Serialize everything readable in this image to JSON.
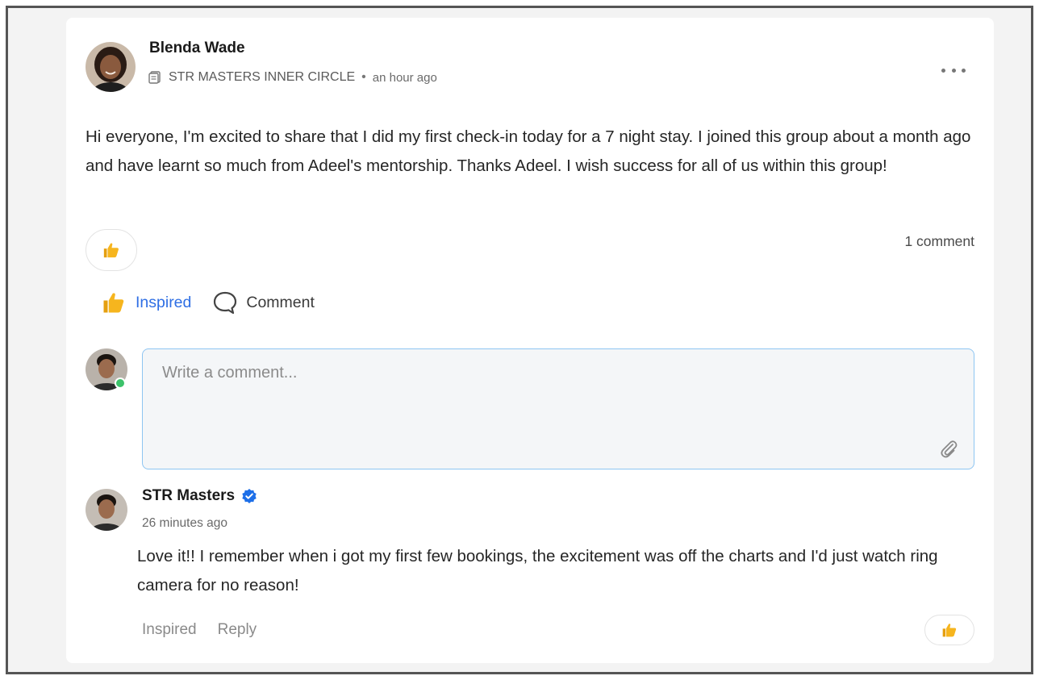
{
  "post": {
    "author_name": "Blenda Wade",
    "group_name": "STR MASTERS INNER CIRCLE",
    "separator": "•",
    "time": "an hour ago",
    "body": "Hi everyone, I'm excited to share that I did my first check-in today for a 7 night stay.  I joined this group about a month ago and have learnt so much from Adeel's mentorship.  Thanks Adeel.  I wish success for all of us within this group!",
    "reaction_icon": "thumbs-up-icon",
    "comment_count": "1 comment"
  },
  "actions": {
    "inspired_label": "Inspired",
    "comment_label": "Comment"
  },
  "composer": {
    "placeholder": "Write a comment...",
    "value": ""
  },
  "comment": {
    "author_name": "STR Masters",
    "verified_icon": "verified-badge-icon",
    "time": "26 minutes ago",
    "body": "Love it!! I remember when i got my first few bookings, the excitement was off the charts and I'd just watch ring camera for no reason!",
    "inspired_label": "Inspired",
    "reply_label": "Reply",
    "reaction_icon": "thumbs-up-icon"
  },
  "colors": {
    "accent_blue": "#2f6fe4",
    "thumb_yellow": "#f6b51e",
    "online_green": "#3cc26a",
    "input_border": "#8ec5f2",
    "verified_blue": "#1d6fe8"
  }
}
